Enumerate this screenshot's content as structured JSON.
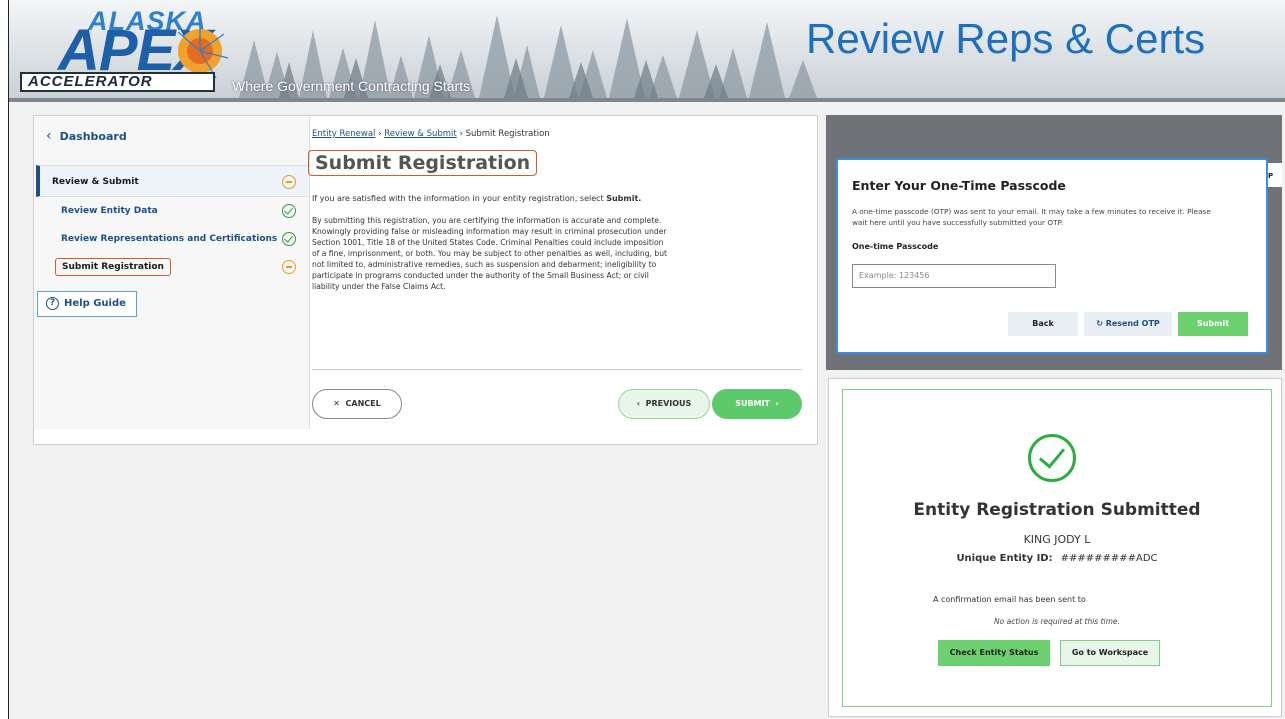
{
  "header": {
    "logo_top": "ALASKA",
    "logo_main": "APEX",
    "logo_bottom": "ACCELERATOR",
    "tagline": "Where Government Contracting Starts",
    "slide_title": "Review Reps & Certs"
  },
  "sidebar": {
    "back_label": "Dashboard",
    "section_label": "Review & Submit",
    "items": [
      {
        "label": "Review Entity Data",
        "status": "complete"
      },
      {
        "label": "Review Representations and Certifications",
        "status": "complete"
      },
      {
        "label": "Submit Registration",
        "status": "in-progress"
      }
    ],
    "help_label": "Help Guide"
  },
  "main": {
    "breadcrumb": [
      "Entity Renewal",
      "Review & Submit",
      "Submit Registration"
    ],
    "title": "Submit Registration",
    "intro_prefix": "If you are satisfied with the information in your entity registration, select ",
    "intro_bold": "Submit.",
    "certification_text": "By submitting this registration, you are certifying the information is accurate and complete. Knowingly providing false or misleading information may result in criminal prosecution under Section 1001, Title 18 of the United States Code. Criminal Penalties could include imposition of a fine, imprisonment, or both. You may be subject to other penalties as well, including, but not limited to, administrative remedies, such as suspension and debarment; ineligibility to participate in programs conducted under the authority of the Small Business Act; or civil liability under the False Claims Act.",
    "cancel_label": "CANCEL",
    "previous_label": "PREVIOUS",
    "submit_label": "SUBMIT"
  },
  "otp_dialog": {
    "title": "Enter Your One-Time Passcode",
    "description": "A one-time passcode (OTP) was sent to your email. It may take a few minutes to receive it. Please wait here until you have successfully submitted your OTP.",
    "field_label": "One-time Passcode",
    "placeholder": "Example: 123456",
    "back_label": "Back",
    "resend_label": "Resend OTP",
    "submit_label": "Submit",
    "cut_text": "P"
  },
  "confirmation": {
    "title": "Entity Registration Submitted",
    "entity_name": "KING JODY L",
    "uei_label": "Unique Entity ID:",
    "uei_value": "#########ADC",
    "email_note": "A confirmation email has been sent to",
    "no_action": "No action is required at this time.",
    "check_status_label": "Check Entity Status",
    "workspace_label": "Go to Workspace"
  },
  "colors": {
    "title_blue": "#1d6fbf",
    "highlight_orange": "#d35b2a",
    "success_green": "#5cc96a",
    "link_blue": "#1e4f87"
  }
}
